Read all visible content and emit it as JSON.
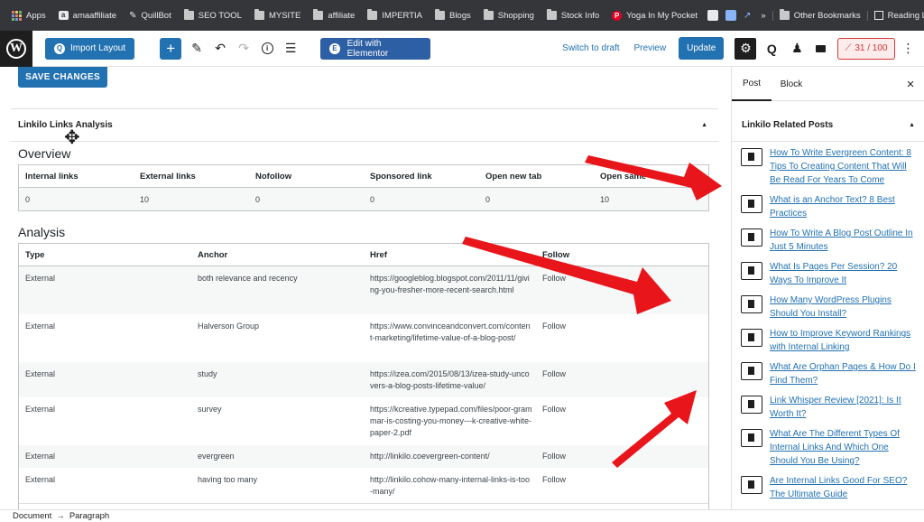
{
  "bookmarks": {
    "items": [
      {
        "label": "Apps",
        "icon": "grid-icon"
      },
      {
        "label": "amaaffiliate",
        "icon": "a-icon"
      },
      {
        "label": "QuillBot",
        "icon": "quill-icon"
      },
      {
        "label": "SEO TOOL",
        "icon": "folder-icon"
      },
      {
        "label": "MYSITE",
        "icon": "folder-icon"
      },
      {
        "label": "affiliate",
        "icon": "folder-icon"
      },
      {
        "label": "IMPERTIA",
        "icon": "folder-icon"
      },
      {
        "label": "Blogs",
        "icon": "folder-icon"
      },
      {
        "label": "Shopping",
        "icon": "folder-icon"
      },
      {
        "label": "Stock Info",
        "icon": "folder-icon"
      },
      {
        "label": "Yoga In My Pocket",
        "icon": "pinterest-icon"
      }
    ],
    "more": "»",
    "other_bookmarks": "Other Bookmarks",
    "reading_list": "Reading List"
  },
  "toolbar": {
    "import_layout": "Import Layout",
    "edit_elementor": "Edit with Elementor",
    "switch_to_draft": "Switch to draft",
    "preview": "Preview",
    "update": "Update",
    "score": "31 / 100"
  },
  "editor": {
    "save_changes": "SAVE CHANGES",
    "panel_title": "Linkilo Links Analysis",
    "overview_heading": "Overview",
    "overview_headers": [
      "Internal links",
      "External links",
      "Nofollow",
      "Sponsored link",
      "Open new tab",
      "Open same"
    ],
    "overview_values": [
      "0",
      "10",
      "0",
      "0",
      "0",
      "10"
    ],
    "analysis_heading": "Analysis",
    "analysis_headers": [
      "Type",
      "Anchor",
      "Href",
      "Follow"
    ],
    "analysis_rows": [
      {
        "type": "External",
        "anchor": "both relevance and recency",
        "href": "https://googleblog.blogspot.com/2011/11/giving-you-fresher-more-recent-search.html",
        "follow": "Follow"
      },
      {
        "type": "External",
        "anchor": "Halverson Group",
        "href": "https://www.convinceandconvert.com/content-marketing/lifetime-value-of-a-blog-post/",
        "follow": "Follow"
      },
      {
        "type": "External",
        "anchor": "study",
        "href": "https://izea.com/2015/08/13/izea-study-uncovers-a-blog-posts-lifetime-value/",
        "follow": "Follow"
      },
      {
        "type": "External",
        "anchor": "survey",
        "href": "https://kcreative.typepad.com/files/poor-grammar-is-costing-you-money---k-creative-white-paper-2.pdf",
        "follow": "Follow"
      },
      {
        "type": "External",
        "anchor": "evergreen",
        "href": "http://linkilo.coevergreen-content/",
        "follow": "Follow"
      },
      {
        "type": "External",
        "anchor": "having too many",
        "href": "http://linkilo.cohow-many-internal-links-is-too-many/",
        "follow": "Follow"
      }
    ]
  },
  "sidebar": {
    "tab_post": "Post",
    "tab_block": "Block",
    "close": "×",
    "related_title": "Linkilo Related Posts",
    "related_posts": [
      "How To Write Evergreen Content: 8 Tips To Creating Content That Will Be Read For Years To Come",
      "What is an Anchor Text? 8 Best Practices",
      "How To Write A Blog Post Outline In Just 5 Minutes",
      "What Is Pages Per Session? 20 Ways To Improve It",
      "How Many WordPress Plugins Should You Install?",
      "How to Improve Keyword Rankings with Internal Linking",
      "What Are Orphan Pages & How Do I Find Them?",
      "Link Whisper Review [2021]: Is It Worth It?",
      "What Are The Different Types Of Internal Links And Which One Should You Be Using?",
      "Are Internal Links Good For SEO? The Ultimate Guide"
    ]
  },
  "footer": {
    "document": "Document",
    "arrow": "→",
    "paragraph": "Paragraph"
  },
  "colors": {
    "accent": "#2271b1",
    "arrow_red": "#e8151b",
    "score_red": "#d63638"
  }
}
